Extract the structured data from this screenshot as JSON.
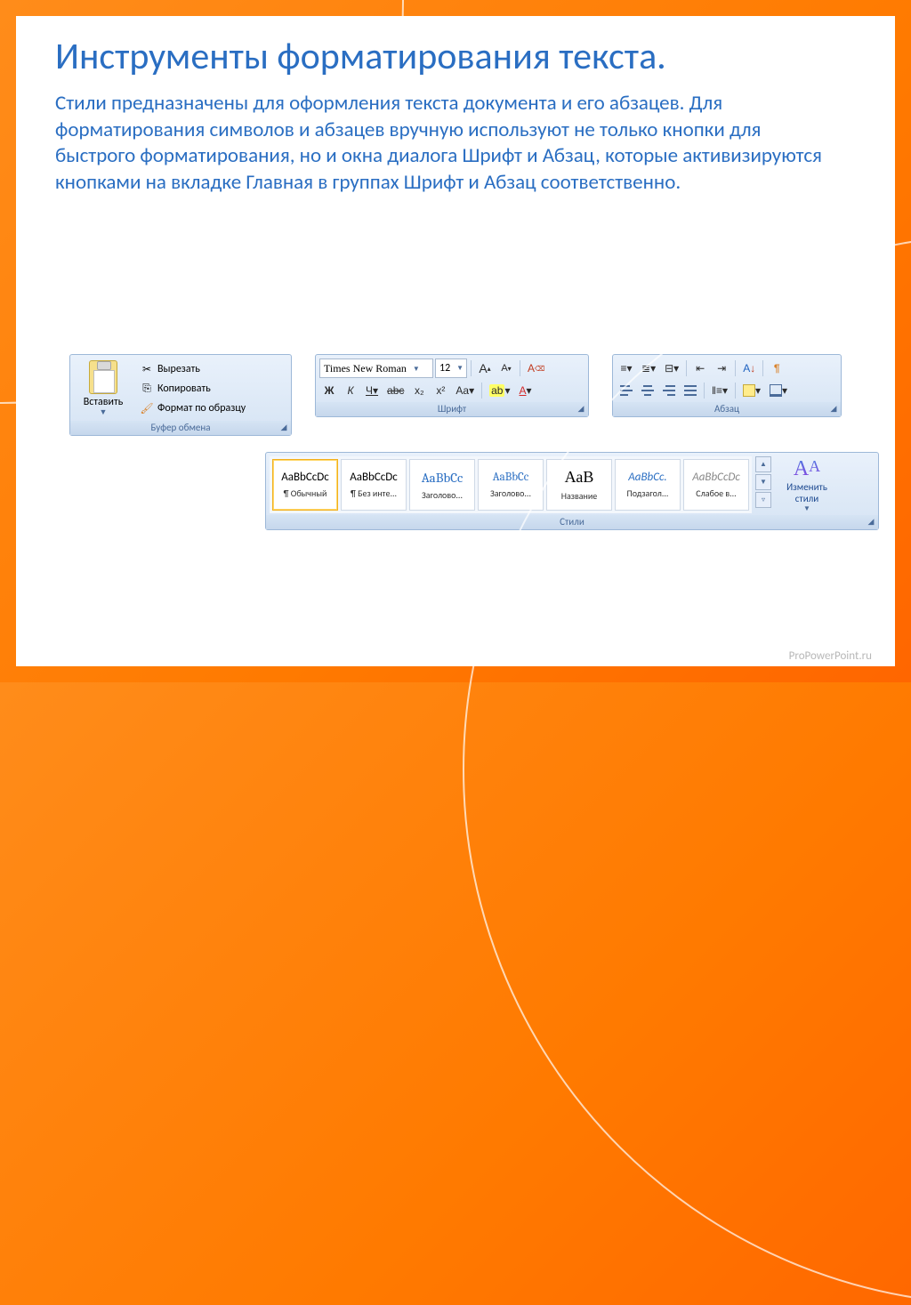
{
  "title": "Инструменты форматирования текста.",
  "body": "Стили предназначены для оформления текста документа и его абзацев. Для форматирования символов и абзацев вручную используют не только кнопки для быстрого форматирования, но и окна диалога Шрифт и Абзац, которые активизируются кнопками на вкладке Главная в группах Шрифт и Абзац соответственно.",
  "clipboard": {
    "panel_label": "Буфер обмена",
    "paste": "Вставить",
    "cut": "Вырезать",
    "copy": "Копировать",
    "format_painter": "Формат по образцу"
  },
  "font": {
    "panel_label": "Шрифт",
    "font_name": "Times New Roman",
    "font_size": "12",
    "bold": "Ж",
    "italic": "К",
    "underline": "Ч",
    "strike": "abc",
    "sub": "x₂",
    "sup": "x²",
    "case": "Aa",
    "clearfmt": "Aᵪ",
    "grow": "A",
    "shrink": "A"
  },
  "paragraph": {
    "panel_label": "Абзац"
  },
  "styles": {
    "panel_label": "Стили",
    "change": "Изменить стили",
    "items": [
      {
        "sample": "AaBbCcDc",
        "name": "¶ Обычный",
        "sel": true,
        "css": ""
      },
      {
        "sample": "AaBbCcDc",
        "name": "¶ Без инте...",
        "css": ""
      },
      {
        "sample": "AaBbCc",
        "name": "Заголово...",
        "css": "color:#2a6ec2;font-family:Cambria,serif;font-size:15px;"
      },
      {
        "sample": "AaBbCc",
        "name": "Заголово...",
        "css": "color:#2a6ec2;font-family:Cambria,serif;"
      },
      {
        "sample": "АаВ",
        "name": "Название",
        "css": "font-family:Cambria,serif;font-size:18px;"
      },
      {
        "sample": "AaBbCc.",
        "name": "Подзагол...",
        "css": "color:#2a6ec2;font-style:italic;"
      },
      {
        "sample": "AaBbCcDc",
        "name": "Слабое в...",
        "css": "color:#888;font-style:italic;"
      }
    ]
  },
  "watermark": "ProPowerPoint.ru"
}
